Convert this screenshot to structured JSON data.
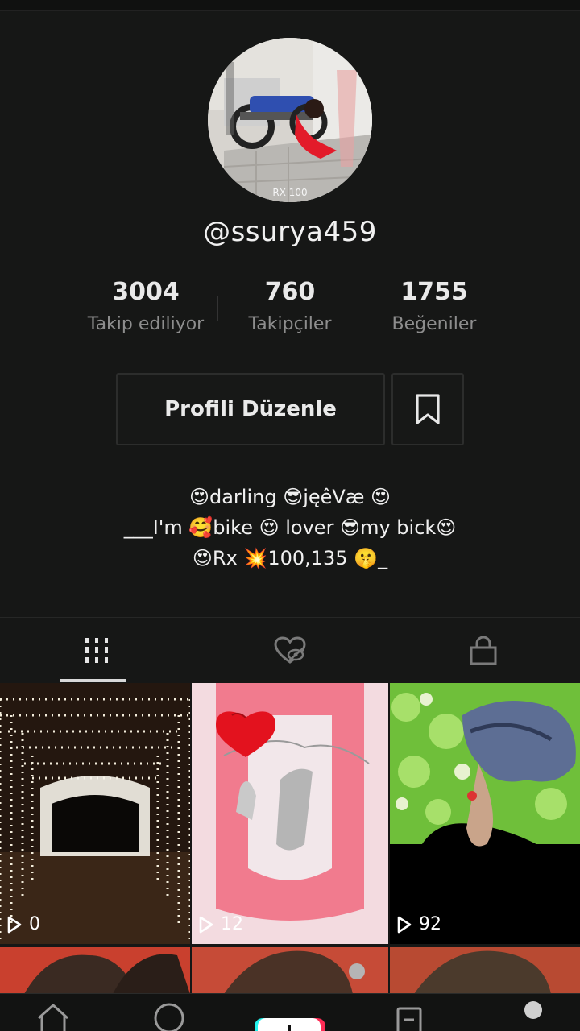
{
  "profile": {
    "username": "@ssurya459",
    "avatar_caption": "RX-100"
  },
  "stats": [
    {
      "value": "3004",
      "label": "Takip ediliyor"
    },
    {
      "value": "760",
      "label": "Takipçiler"
    },
    {
      "value": "1755",
      "label": "Beğeniler"
    }
  ],
  "actions": {
    "edit_label": "Profili Düzenle",
    "bookmark_icon": "bookmark-icon"
  },
  "bio": {
    "line1": "😍darling 😎jęêVæ 😍",
    "line2": "___I'm 🥰bike 😍 lover 😎my bick😍",
    "line3": "😍Rx 💥100,135 🤫_"
  },
  "tabs": [
    {
      "name": "videos",
      "icon": "grid-bars-icon",
      "active": true
    },
    {
      "name": "liked",
      "icon": "hidden-heart-icon",
      "active": false
    },
    {
      "name": "private",
      "icon": "lock-icon",
      "active": false
    }
  ],
  "videos": [
    {
      "views": "0"
    },
    {
      "views": "12"
    },
    {
      "views": "92"
    }
  ],
  "bottom_nav": [
    "home-icon",
    "discover-icon",
    "create-icon",
    "inbox-icon",
    "profile-icon"
  ],
  "colors": {
    "background": "#161716",
    "muted_text": "#8d8d8d",
    "border": "#2c2d2c",
    "accent_cyan": "#25f4ee",
    "accent_pink": "#fe2c55"
  }
}
